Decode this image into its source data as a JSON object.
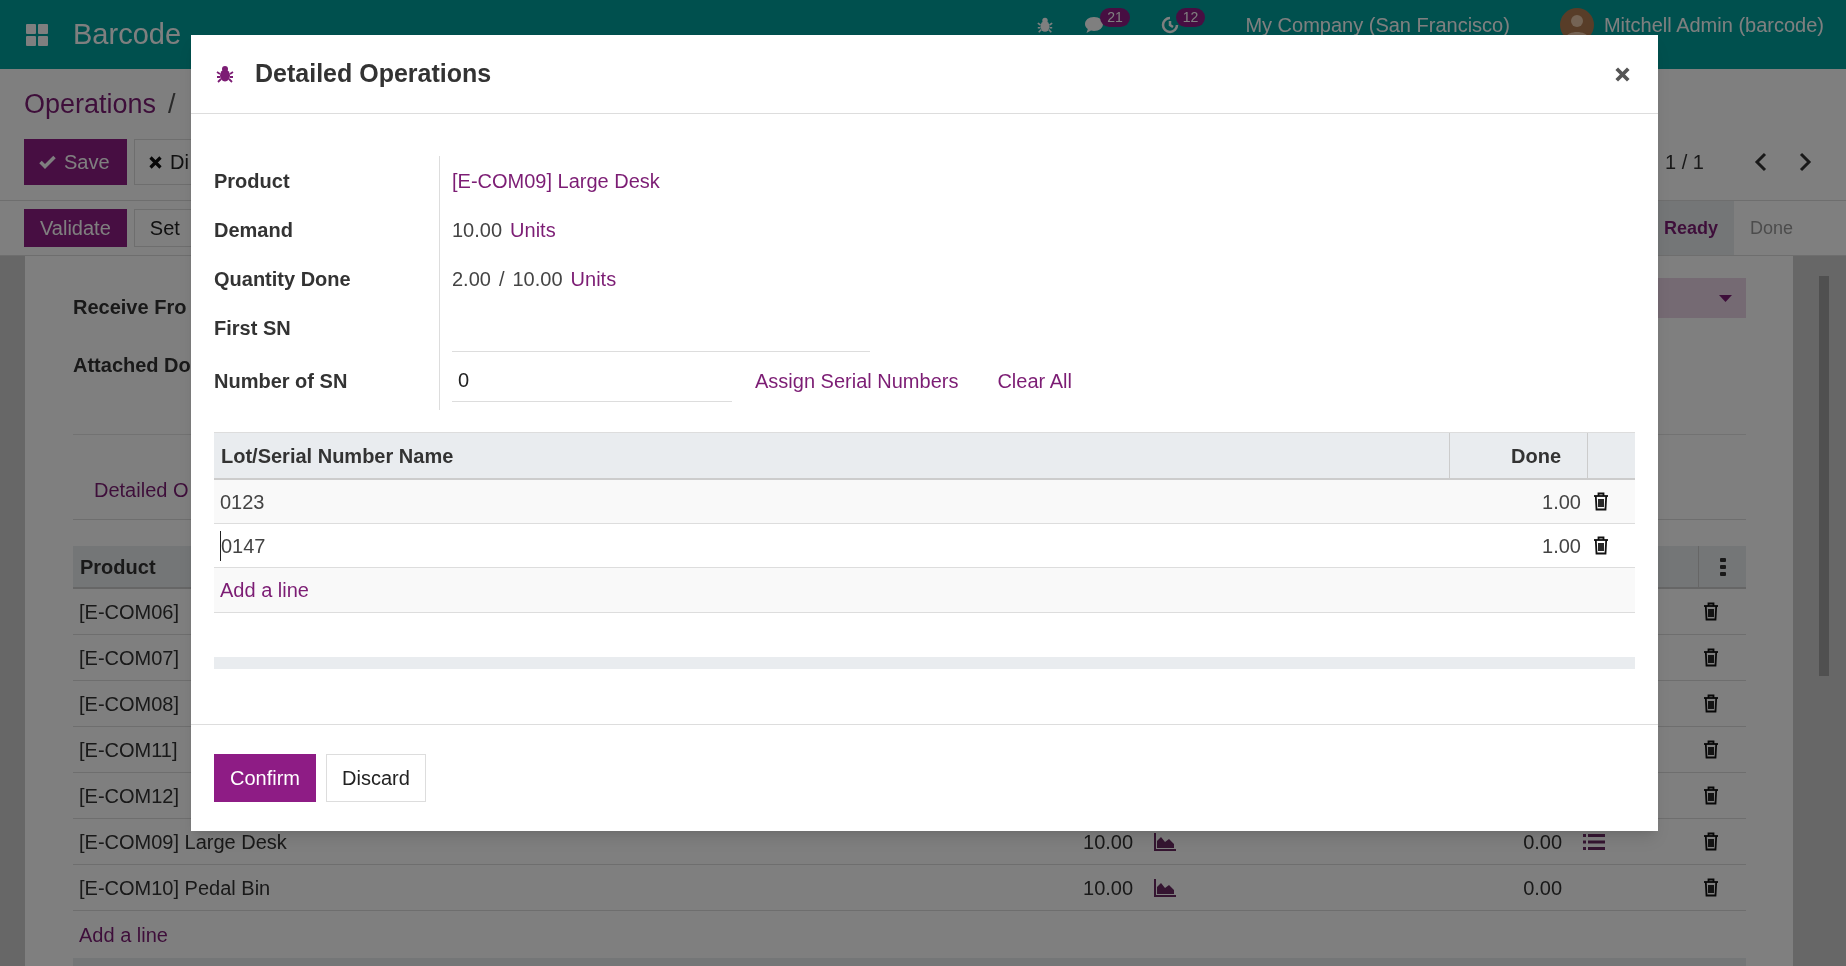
{
  "navbar": {
    "app_name": "Barcode",
    "chat_count": "21",
    "activity_count": "12",
    "company": "My Company (San Francisco)",
    "user": "Mitchell Admin (barcode)"
  },
  "breadcrumb": {
    "root": "Operations",
    "separator": "/"
  },
  "buttons": [
    {
      "label": "Save",
      "kind": "primary"
    },
    {
      "label": "Di",
      "kind": "secondary"
    }
  ],
  "pager": "1 / 1",
  "action_buttons": [
    {
      "label": "Validate",
      "kind": "primary"
    },
    {
      "label": "Set",
      "kind": "secondary"
    }
  ],
  "stages": [
    {
      "label": "Ready",
      "selected": true
    },
    {
      "label": "Done",
      "selected": false
    }
  ],
  "form": {
    "fields": [
      "Receive Fro",
      "Attached Do"
    ],
    "tab": "Detailed O"
  },
  "operations": {
    "header": "Product",
    "rows": [
      {
        "product": "[E-COM06]"
      },
      {
        "product": "[E-COM07]"
      },
      {
        "product": "[E-COM08]"
      },
      {
        "product": "[E-COM11]"
      },
      {
        "product": "[E-COM12]"
      },
      {
        "product": "[E-COM09] Large Desk",
        "demand": "10.00",
        "done": "0.00",
        "has_details": true
      },
      {
        "product": "[E-COM10] Pedal Bin",
        "demand": "10.00",
        "done": "0.00",
        "has_details": false
      }
    ],
    "add_line": "Add a line"
  },
  "dialog": {
    "title": "Detailed Operations",
    "product_label": "Product",
    "product": "[E-COM09] Large Desk",
    "demand_label": "Demand",
    "demand": "10.00",
    "demand_unit": "Units",
    "qty_label": "Quantity Done",
    "qty_done": "2.00",
    "qty_sep": "/",
    "qty_total": "10.00",
    "qty_unit": "Units",
    "first_sn_label": "First SN",
    "number_sn_label": "Number of SN",
    "number_sn": "0",
    "assign_link": "Assign Serial Numbers",
    "clear_link": "Clear All",
    "table": {
      "columns": [
        "Lot/Serial Number Name",
        "Done"
      ],
      "rows": [
        {
          "name": "0123",
          "done": "1.00",
          "editing": false
        },
        {
          "name": "0147",
          "done": "1.00",
          "editing": true
        }
      ],
      "add_line": "Add a line"
    },
    "buttons": [
      {
        "label": "Confirm",
        "kind": "primary"
      },
      {
        "label": "Discard",
        "kind": "secondary"
      }
    ]
  }
}
